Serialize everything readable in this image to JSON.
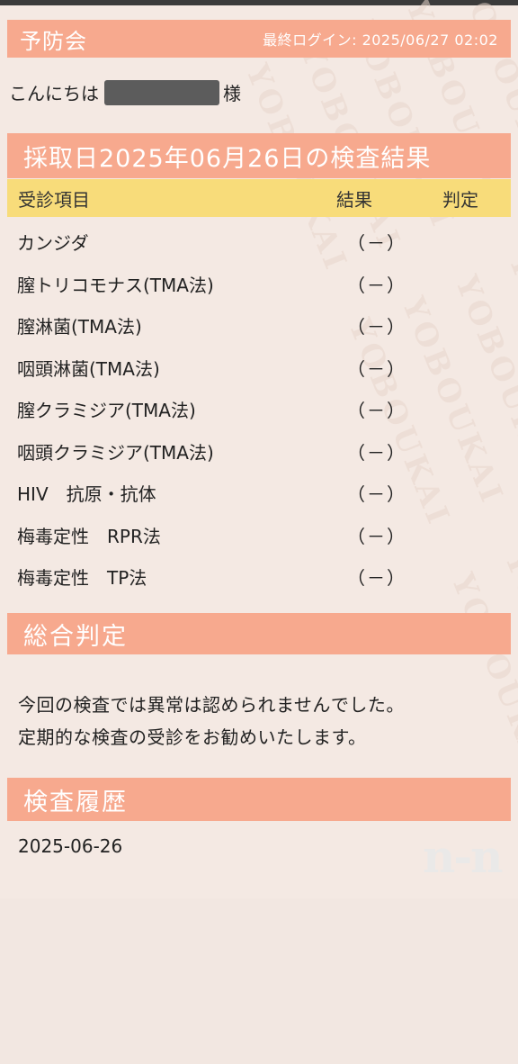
{
  "header": {
    "app_name": "予防会",
    "last_login": "最終ログイン: 2025/06/27 02:02"
  },
  "greeting": {
    "prefix": "こんにちは",
    "suffix": "様"
  },
  "results": {
    "title": "採取日2025年06月26日の検査結果",
    "columns": {
      "item": "受診項目",
      "result": "結果",
      "judgement": "判定"
    },
    "rows": [
      {
        "item": "カンジダ",
        "result": "（－）",
        "judgement": ""
      },
      {
        "item": "膣トリコモナス(TMA法)",
        "result": "（－）",
        "judgement": ""
      },
      {
        "item": "膣淋菌(TMA法)",
        "result": "（－）",
        "judgement": ""
      },
      {
        "item": "咽頭淋菌(TMA法)",
        "result": "（－）",
        "judgement": ""
      },
      {
        "item": "膣クラミジア(TMA法)",
        "result": "（－）",
        "judgement": ""
      },
      {
        "item": "咽頭クラミジア(TMA法)",
        "result": "（－）",
        "judgement": ""
      },
      {
        "item": "HIV　抗原・抗体",
        "result": "（－）",
        "judgement": ""
      },
      {
        "item": "梅毒定性　RPR法",
        "result": "（－）",
        "judgement": ""
      },
      {
        "item": "梅毒定性　TP法",
        "result": "（－）",
        "judgement": ""
      }
    ]
  },
  "summary": {
    "title": "総合判定",
    "line1": "今回の検査では異常は認められませんでした。",
    "line2": "定期的な検査の受診をお勧めいたします。"
  },
  "history": {
    "title": "検査履歴",
    "dates": [
      "2025-06-26"
    ]
  },
  "watermark": "YOBOUKAI",
  "logo_text": "n-n",
  "colors": {
    "accent": "#f7a98e",
    "table_header": "#f8dc7a",
    "background": "#f4e9e3"
  }
}
